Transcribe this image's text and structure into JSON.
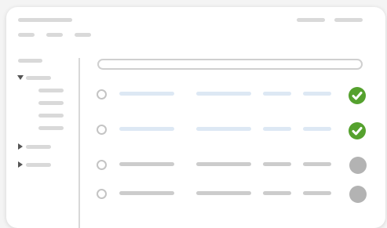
{
  "theme": {
    "success_color": "#55a12e",
    "pending_color": "#b3b3b3",
    "highlight_bar_color": "#dde8f4",
    "placeholder_bar_color": "#d9d9d9"
  },
  "sidebar": {
    "groups": [
      {
        "state": "expanded",
        "icon": "caret-down-icon",
        "child_count": 4
      },
      {
        "state": "collapsed",
        "icon": "caret-right-icon",
        "child_count": 0
      },
      {
        "state": "collapsed",
        "icon": "caret-right-icon",
        "child_count": 0
      }
    ]
  },
  "list": {
    "rows": [
      {
        "highlighted": true,
        "status": "success",
        "status_icon": "check-icon"
      },
      {
        "highlighted": true,
        "status": "success",
        "status_icon": "check-icon"
      },
      {
        "highlighted": false,
        "status": "pending",
        "status_icon": "pending-dot-icon"
      },
      {
        "highlighted": false,
        "status": "pending",
        "status_icon": "pending-dot-icon"
      }
    ]
  }
}
